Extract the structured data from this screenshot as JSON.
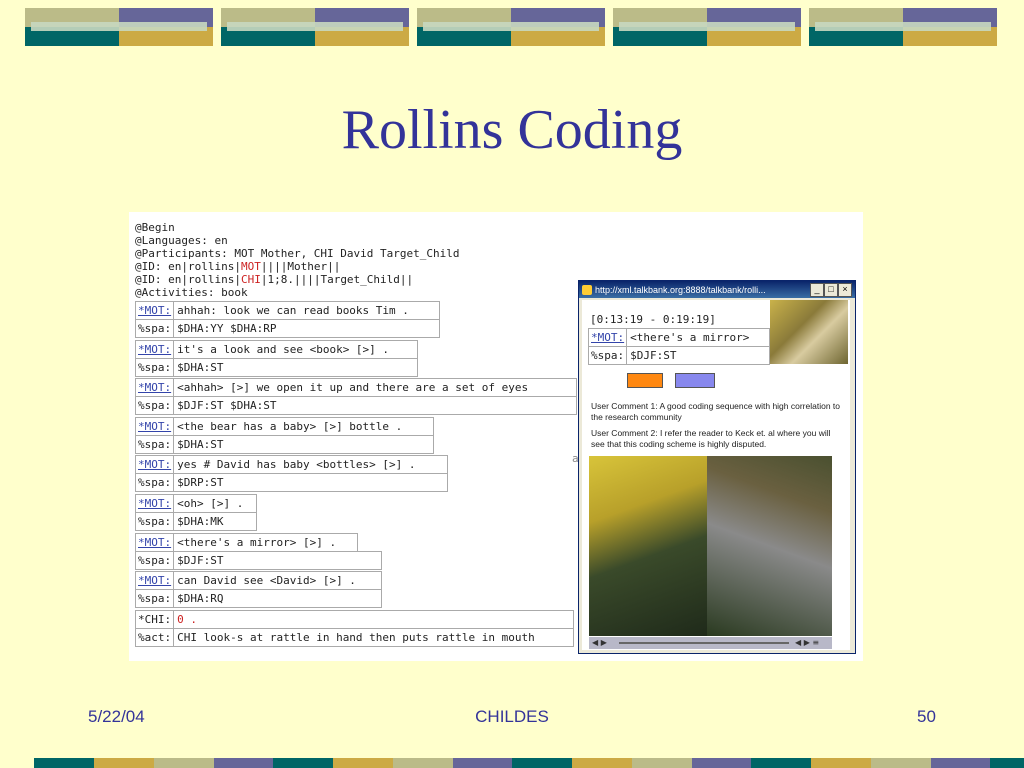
{
  "slide": {
    "title": "Rollins Coding",
    "footer_date": "5/22/04",
    "footer_center": "CHILDES",
    "footer_page": "50"
  },
  "colors": {
    "background": "#ffffcc",
    "title": "#333399",
    "deco_teal": "#006666",
    "deco_tan": "#ccaa44",
    "deco_sage": "#bbbb88",
    "deco_purple": "#666699"
  },
  "transcript": {
    "header_lines": [
      "@Begin",
      "@Languages: en",
      "@Participants: MOT Mother, CHI David Target_Child",
      "@ID: en|rollins|MOT||||Mother||",
      "@ID: en|rollins|CHI|1;8.||||Target_Child||",
      "@Activities: book"
    ],
    "utterances": [
      {
        "speaker": "*MOT:",
        "text": "ahhah: look we can read books Tim .",
        "tier": "%spa:",
        "code": "$DHA:YY $DHA:RP"
      },
      {
        "speaker": "*MOT:",
        "text": "it's a look and see <book> [>] .",
        "tier": "%spa:",
        "code": "$DHA:ST"
      },
      {
        "speaker": "*MOT:",
        "text": "<ahhah> [>] we open it up and there are a set of eyes",
        "tier": "%spa:",
        "code": "$DJF:ST $DHA:ST"
      },
      {
        "speaker": "*MOT:",
        "text": "<the bear has a baby> [>] bottle .",
        "tier": "%spa:",
        "code": "$DHA:ST"
      },
      {
        "speaker": "*MOT:",
        "text": "yes # David has baby <bottles> [>] .",
        "tier": "%spa:",
        "code": "$DRP:ST"
      },
      {
        "speaker": "*MOT:",
        "text": "<oh> [>] .",
        "tier": "%spa:",
        "code": "$DHA:MK"
      },
      {
        "speaker": "*MOT:",
        "text": "<there's a mirror> [>] .",
        "tier": "%spa:",
        "code": "$DJF:ST"
      },
      {
        "speaker": "*MOT:",
        "text": "can David see <David> [>] .",
        "tier": "%spa:",
        "code": "$DHA:RQ"
      },
      {
        "speaker": "*CHI:",
        "text": "0 .",
        "tier": "%act:",
        "code": "CHI look-s at rattle in hand then puts rattle in mouth"
      }
    ]
  },
  "popup": {
    "title": "http://xml.talkbank.org:8888/talkbank/rolli...",
    "timestamp": "[0:13:19 - 0:19:19]",
    "speaker": "*MOT:",
    "utterance": "<there's a mirror>",
    "tier": "%spa:",
    "code": "$DJF:ST",
    "swatch_colors": [
      "#ff8811",
      "#8888ee"
    ],
    "comment1": "User Comment 1: A good coding sequence with high correlation to the research community",
    "comment2": "User Comment 2: I refer the reader to Keck et. al where you will see that this coding scheme is highly disputed."
  }
}
